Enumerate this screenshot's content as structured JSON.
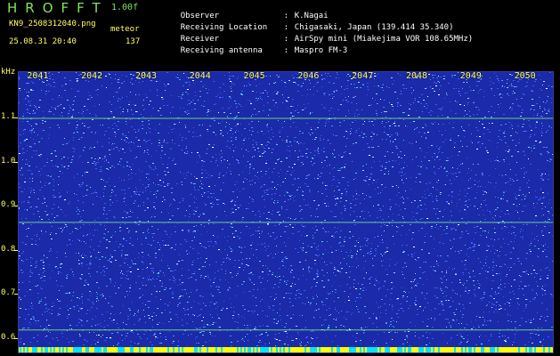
{
  "header": {
    "app_title": "HROFFT",
    "version": "1.00f",
    "filename": "KN9_2508312040.png",
    "mode": "meteor",
    "datetime": "25.08.31 20:40",
    "count": "137",
    "fields": [
      {
        "label": "Observer",
        "value": "K.Nagai"
      },
      {
        "label": "Receiving Location",
        "value": "Chigasaki, Japan (139.414 35.340)"
      },
      {
        "label": "Receiver",
        "value": "AirSpy mini (Miakejima VOR 108.65MHz)"
      },
      {
        "label": "Receiving antenna",
        "value": "Maspro FM-3"
      }
    ],
    "separator": ":"
  },
  "axis": {
    "unit": "kHz",
    "y_ticks": [
      "1.1",
      "1.0",
      "0.9",
      "0.8",
      "0.7",
      "0.6"
    ],
    "y_values": [
      1.1,
      1.0,
      0.9,
      0.8,
      0.7,
      0.6
    ],
    "y_range": [
      0.565,
      1.205
    ],
    "x_ticks": [
      "2041",
      "2042",
      "2043",
      "2044",
      "2045",
      "2046",
      "2047",
      "2048",
      "2049",
      "2050"
    ],
    "x_values": [
      2041,
      2042,
      2043,
      2044,
      2045,
      2046,
      2047,
      2048,
      2049,
      2050
    ],
    "x_range": [
      2040.6,
      2050.5
    ]
  },
  "spectrogram": {
    "background_color": "#1a2aa8",
    "speckle_colors": [
      "#3a5cff",
      "#5a8cff",
      "#9ad8ff",
      "#ffffff",
      "#44e0d0"
    ],
    "line_color": "#88ff88",
    "signal_lines_khz": [
      1.098,
      0.862,
      0.618
    ],
    "bottom_bar_colors": [
      "#ffff00",
      "#00e5ff"
    ]
  }
}
